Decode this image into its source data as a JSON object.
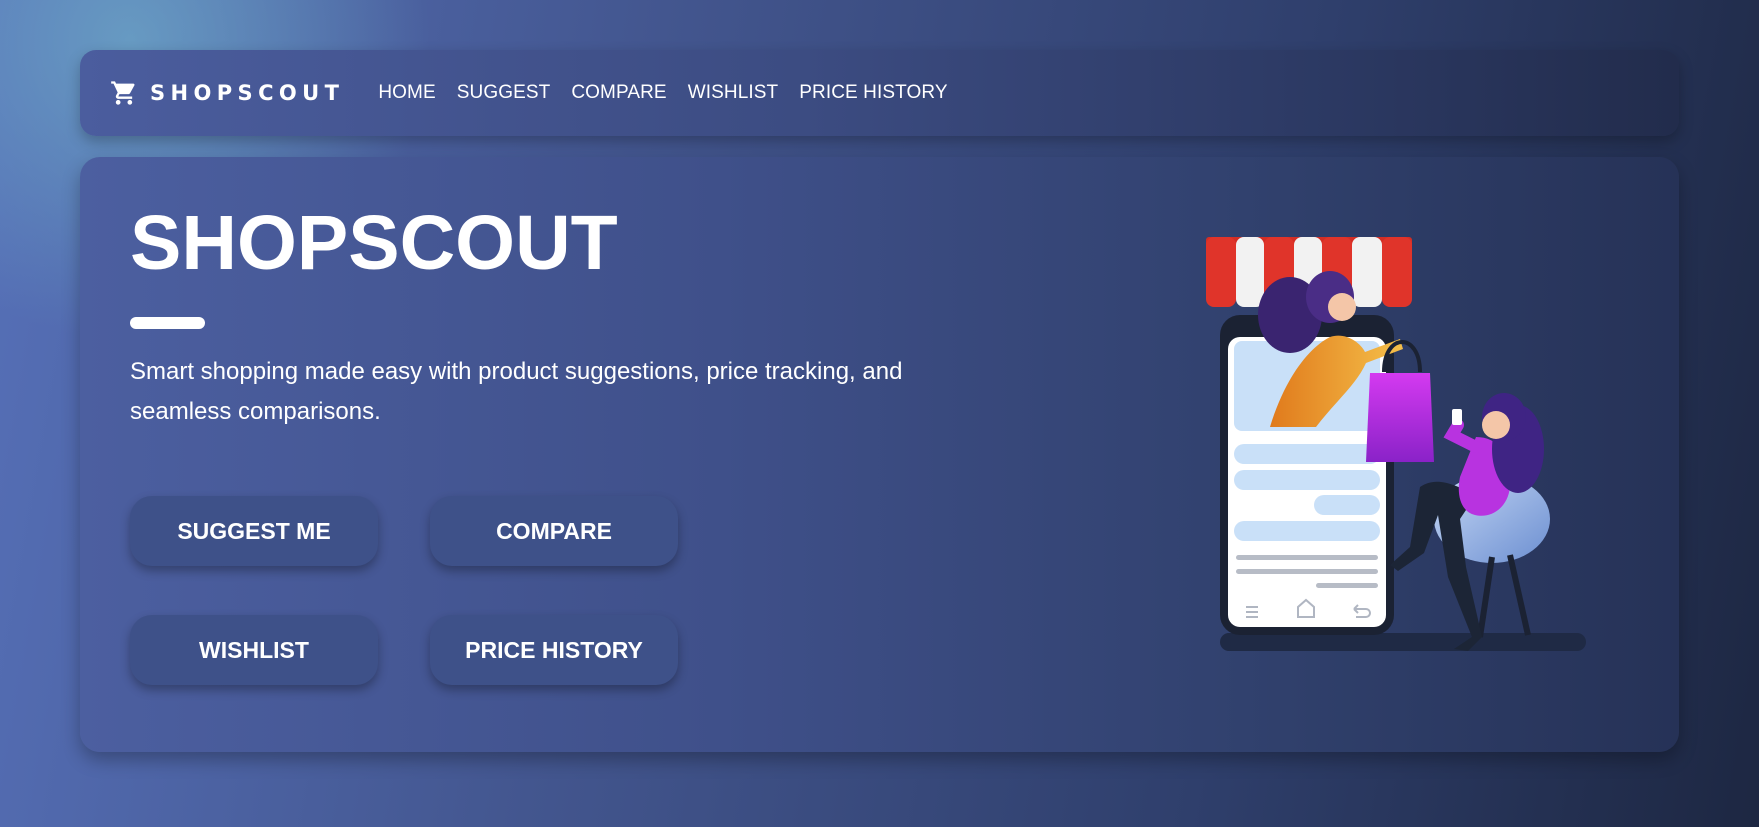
{
  "nav": {
    "brand": "SHOPSCOUT",
    "brand_icon": "shopping-cart-icon",
    "links": [
      "HOME",
      "SUGGEST",
      "COMPARE",
      "WISHLIST",
      "PRICE HISTORY"
    ]
  },
  "hero": {
    "title": "SHOPSCOUT",
    "description": "Smart shopping made easy with product suggestions, price tracking, and seamless comparisons.",
    "buttons": {
      "suggest": "SUGGEST ME",
      "compare": "COMPARE",
      "wishlist": "WISHLIST",
      "price_history": "PRICE HISTORY"
    },
    "illustration": "online-shopping-illustration"
  },
  "colors": {
    "button_bg": "#3e5189",
    "awning_red": "#e0342a",
    "bag_purple": "#c22fe0",
    "text": "#ffffff"
  }
}
